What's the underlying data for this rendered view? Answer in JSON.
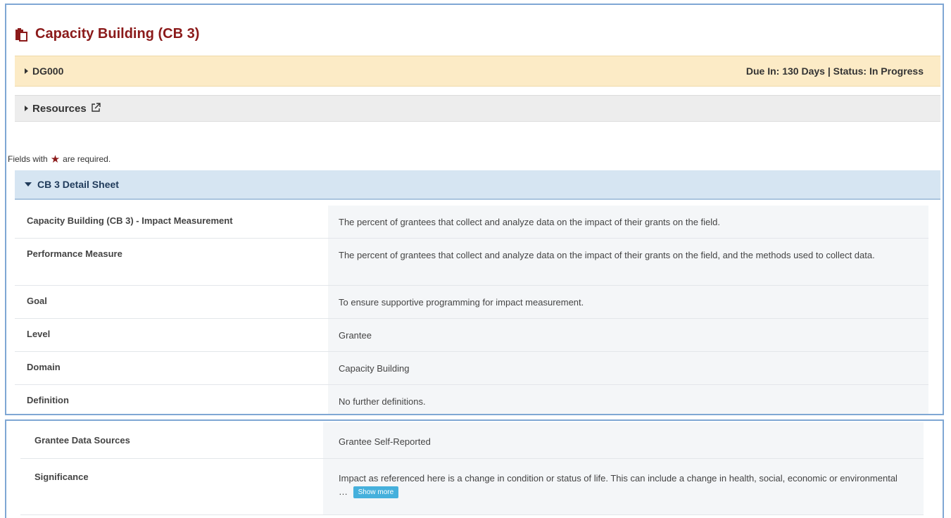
{
  "page": {
    "title": "Capacity Building (CB 3)"
  },
  "grant_bar": {
    "id": "DG000",
    "status_text": "Due In: 130 Days | Status: In Progress"
  },
  "resources": {
    "label": "Resources"
  },
  "required_note": {
    "prefix": "Fields with",
    "suffix": "are required."
  },
  "section": {
    "title": "CB 3 Detail Sheet"
  },
  "rows_top": [
    {
      "label": "Capacity Building (CB 3) - Impact Measurement",
      "value": "The percent of grantees that collect and analyze data on the impact of their grants on the field."
    },
    {
      "label": "Performance Measure",
      "value": "The percent of grantees that collect and analyze data on the impact of their grants on the field, and the methods used to collect data."
    },
    {
      "label": "Goal",
      "value": "To ensure supportive programming for impact measurement."
    },
    {
      "label": "Level",
      "value": "Grantee"
    },
    {
      "label": "Domain",
      "value": "Capacity Building"
    },
    {
      "label": "Definition",
      "value": "No further definitions."
    }
  ],
  "rows_bottom": [
    {
      "label": "Grantee Data Sources",
      "value": "Grantee Self-Reported"
    },
    {
      "label": "Significance",
      "value": "Impact as referenced here is a change in condition or status of life. This can include a change in health, social, economic or environmental …",
      "show_more": "Show more"
    }
  ],
  "colors": {
    "title": "#8b1a1a",
    "grant_bar_bg": "#fcebc6",
    "section_bg": "#d6e5f2",
    "frame_border": "#7fa7d4",
    "show_more_bg": "#45b0dc"
  }
}
